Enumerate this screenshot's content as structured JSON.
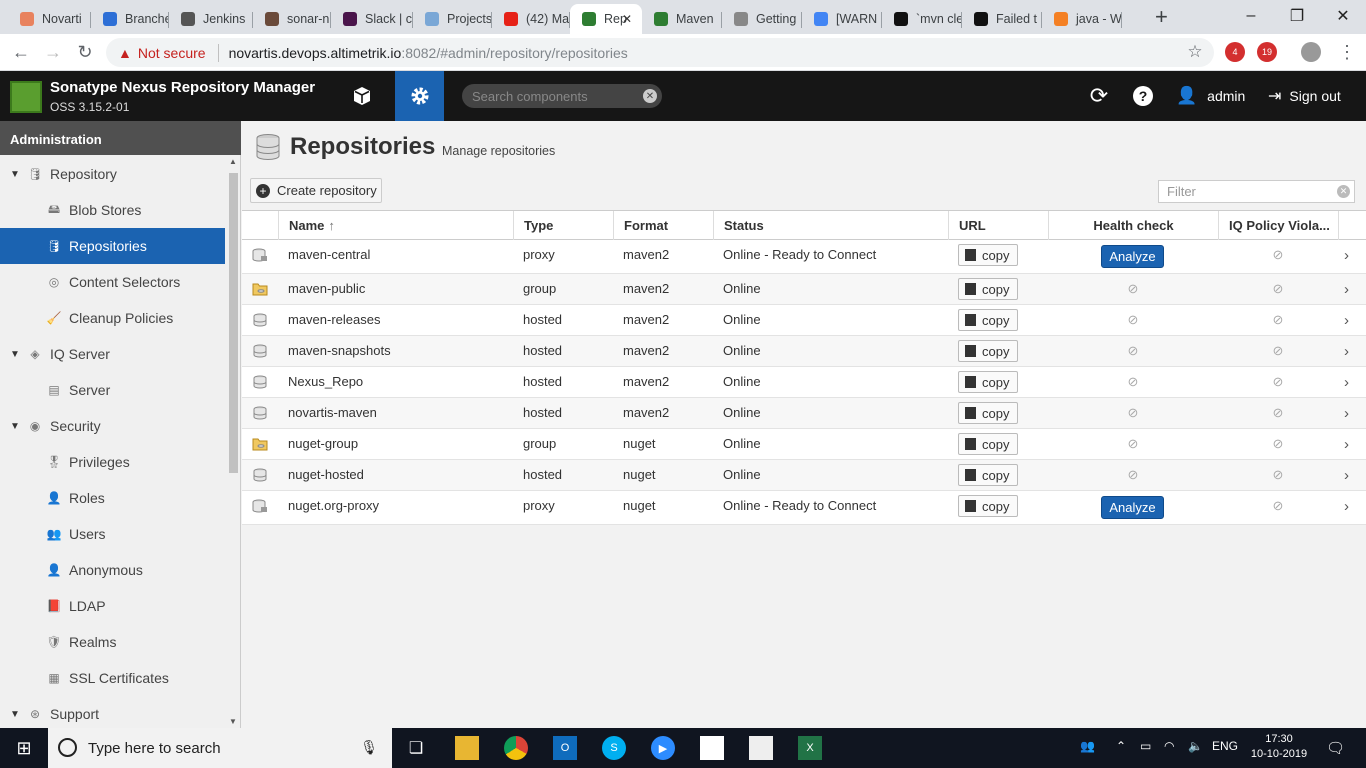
{
  "browser": {
    "tabs": [
      {
        "title": "Novarti",
        "color": "#e8825e"
      },
      {
        "title": "Branche",
        "color": "#2d6fd6"
      },
      {
        "title": "Jenkins",
        "color": "#555555"
      },
      {
        "title": "sonar-n",
        "color": "#6a4a3a"
      },
      {
        "title": "Slack | c",
        "color": "#4a154b"
      },
      {
        "title": "Projects",
        "color": "#7aa7d6"
      },
      {
        "title": "(42) Ma",
        "color": "#e62117"
      },
      {
        "title": "Rep",
        "color": "#2e7d32"
      },
      {
        "title": "Maven",
        "color": "#2e7d32"
      },
      {
        "title": "Getting",
        "color": "#888888"
      },
      {
        "title": "[WARN",
        "color": "#4285f4"
      },
      {
        "title": "`mvn cle",
        "color": "#111111"
      },
      {
        "title": "Failed t",
        "color": "#111111"
      },
      {
        "title": "java - W",
        "color": "#f48024"
      }
    ],
    "not_secure": "Not secure",
    "url_host": "novartis.devops.altimetrik.io",
    "url_path": ":8082/#admin/repository/repositories",
    "ext_badges": [
      "4",
      "19"
    ]
  },
  "header": {
    "product": "Sonatype Nexus Repository Manager",
    "version": "OSS 3.15.2-01",
    "search_placeholder": "Search components",
    "user": "admin",
    "sign_out": "Sign out"
  },
  "sidebar": {
    "title": "Administration",
    "items": [
      {
        "label": "Repository",
        "level": 0,
        "icon": "database-icon",
        "glyph": "🛢",
        "expanded": true
      },
      {
        "label": "Blob Stores",
        "level": 1,
        "icon": "blob-store-icon",
        "glyph": "🖴"
      },
      {
        "label": "Repositories",
        "level": 1,
        "icon": "database-icon",
        "glyph": "🛢",
        "selected": true
      },
      {
        "label": "Content Selectors",
        "level": 1,
        "icon": "selector-icon",
        "glyph": "◎"
      },
      {
        "label": "Cleanup Policies",
        "level": 1,
        "icon": "broom-icon",
        "glyph": "🧹"
      },
      {
        "label": "IQ Server",
        "level": 0,
        "icon": "iq-server-icon",
        "glyph": "◈",
        "expanded": true
      },
      {
        "label": "Server",
        "level": 1,
        "icon": "server-icon",
        "glyph": "▤"
      },
      {
        "label": "Security",
        "level": 0,
        "icon": "security-icon",
        "glyph": "◉",
        "expanded": true
      },
      {
        "label": "Privileges",
        "level": 1,
        "icon": "medal-icon",
        "glyph": "🎖"
      },
      {
        "label": "Roles",
        "level": 1,
        "icon": "role-icon",
        "glyph": "👤"
      },
      {
        "label": "Users",
        "level": 1,
        "icon": "users-icon",
        "glyph": "👥"
      },
      {
        "label": "Anonymous",
        "level": 1,
        "icon": "anonymous-icon",
        "glyph": "👤"
      },
      {
        "label": "LDAP",
        "level": 1,
        "icon": "book-icon",
        "glyph": "📕"
      },
      {
        "label": "Realms",
        "level": 1,
        "icon": "shield-icon",
        "glyph": "🛡"
      },
      {
        "label": "SSL Certificates",
        "level": 1,
        "icon": "certificate-icon",
        "glyph": "▦"
      },
      {
        "label": "Support",
        "level": 0,
        "icon": "support-icon",
        "glyph": "⊛",
        "expanded": true
      }
    ]
  },
  "page": {
    "title": "Repositories",
    "subtitle": "Manage repositories",
    "create_label": "Create repository",
    "filter_placeholder": "Filter"
  },
  "grid": {
    "columns": [
      "Name",
      "Type",
      "Format",
      "Status",
      "URL",
      "Health check",
      "IQ Policy Viola..."
    ],
    "sort_arrow": "↑",
    "copy_label": "copy",
    "analyze_label": "Analyze",
    "rows": [
      {
        "name": "maven-central",
        "type": "proxy",
        "format": "maven2",
        "status": "Online - Ready to Connect",
        "health": "analyze"
      },
      {
        "name": "maven-public",
        "type": "group",
        "format": "maven2",
        "status": "Online",
        "health": "none"
      },
      {
        "name": "maven-releases",
        "type": "hosted",
        "format": "maven2",
        "status": "Online",
        "health": "none"
      },
      {
        "name": "maven-snapshots",
        "type": "hosted",
        "format": "maven2",
        "status": "Online",
        "health": "none"
      },
      {
        "name": "Nexus_Repo",
        "type": "hosted",
        "format": "maven2",
        "status": "Online",
        "health": "none"
      },
      {
        "name": "novartis-maven",
        "type": "hosted",
        "format": "maven2",
        "status": "Online",
        "health": "none"
      },
      {
        "name": "nuget-group",
        "type": "group",
        "format": "nuget",
        "status": "Online",
        "health": "none"
      },
      {
        "name": "nuget-hosted",
        "type": "hosted",
        "format": "nuget",
        "status": "Online",
        "health": "none"
      },
      {
        "name": "nuget.org-proxy",
        "type": "proxy",
        "format": "nuget",
        "status": "Online - Ready to Connect",
        "health": "analyze"
      }
    ]
  },
  "taskbar": {
    "search_placeholder": "Type here to search",
    "lang": "ENG",
    "time": "17:30",
    "date": "10-10-2019"
  },
  "colors": {
    "accent": "#1b63b1",
    "header_bg": "#161616"
  }
}
